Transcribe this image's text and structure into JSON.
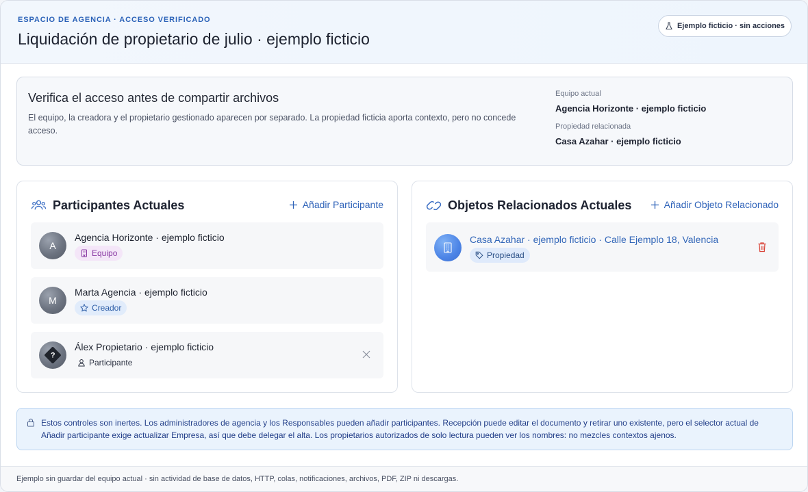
{
  "header": {
    "eyebrow": "ESPACIO DE AGENCIA · ACCESO VERIFICADO",
    "title": "Liquidación de propietario de julio · ejemplo ficticio",
    "demo_pill": "Ejemplo ficticio · sin acciones"
  },
  "verify": {
    "title": "Verifica el acceso antes de compartir archivos",
    "text": "El equipo, la creadora y el propietario gestionado aparecen por separado. La propiedad ficticia aporta contexto, pero no concede acceso.",
    "team_label": "Equipo actual",
    "team_value": "Agencia Horizonte · ejemplo ficticio",
    "property_label": "Propiedad relacionada",
    "property_value": "Casa Azahar · ejemplo ficticio"
  },
  "participants": {
    "title": "Participantes Actuales",
    "add_label": "Añadir Participante",
    "items": [
      {
        "initial": "A",
        "name": "Agencia Horizonte · ejemplo ficticio",
        "role": "Equipo"
      },
      {
        "initial": "M",
        "name": "Marta Agencia · ejemplo ficticio",
        "role": "Creador"
      },
      {
        "initial": "?",
        "name": "Álex Propietario · ejemplo ficticio",
        "role": "Participante"
      }
    ]
  },
  "related": {
    "title": "Objetos Relacionados Actuales",
    "add_label": "Añadir Objeto Relacionado",
    "items": [
      {
        "name": "Casa Azahar · ejemplo ficticio · Calle Ejemplo 18, Valencia",
        "type": "Propiedad"
      }
    ]
  },
  "notice": {
    "text": "Estos controles son inertes. Los administradores de agencia y los Responsables pueden añadir participantes. Recepción puede editar el documento y retirar uno existente, pero el selector actual de Añadir participante exige actualizar Empresa, así que debe delegar el alta. Los propietarios autorizados de solo lectura pueden ver los nombres: no mezcles contextos ajenos."
  },
  "footer": {
    "text": "Ejemplo sin guardar del equipo actual · sin actividad de base de datos, HTTP, colas, notificaciones, archivos, PDF, ZIP ni descargas."
  },
  "colors": {
    "accent": "#2f63b9",
    "team_badge": "#8a3aa3",
    "creator_badge": "#2e5fa8",
    "danger": "#d9463b"
  },
  "icons": {
    "demo": "flask-icon",
    "participants": "users-icon",
    "related": "link-icon",
    "add": "plus-icon",
    "team": "building-icon",
    "creator": "star-icon",
    "participant": "user-icon",
    "remove": "close-icon",
    "property": "building-icon",
    "type": "tag-icon",
    "delete": "trash-icon",
    "notice": "lock-icon"
  }
}
